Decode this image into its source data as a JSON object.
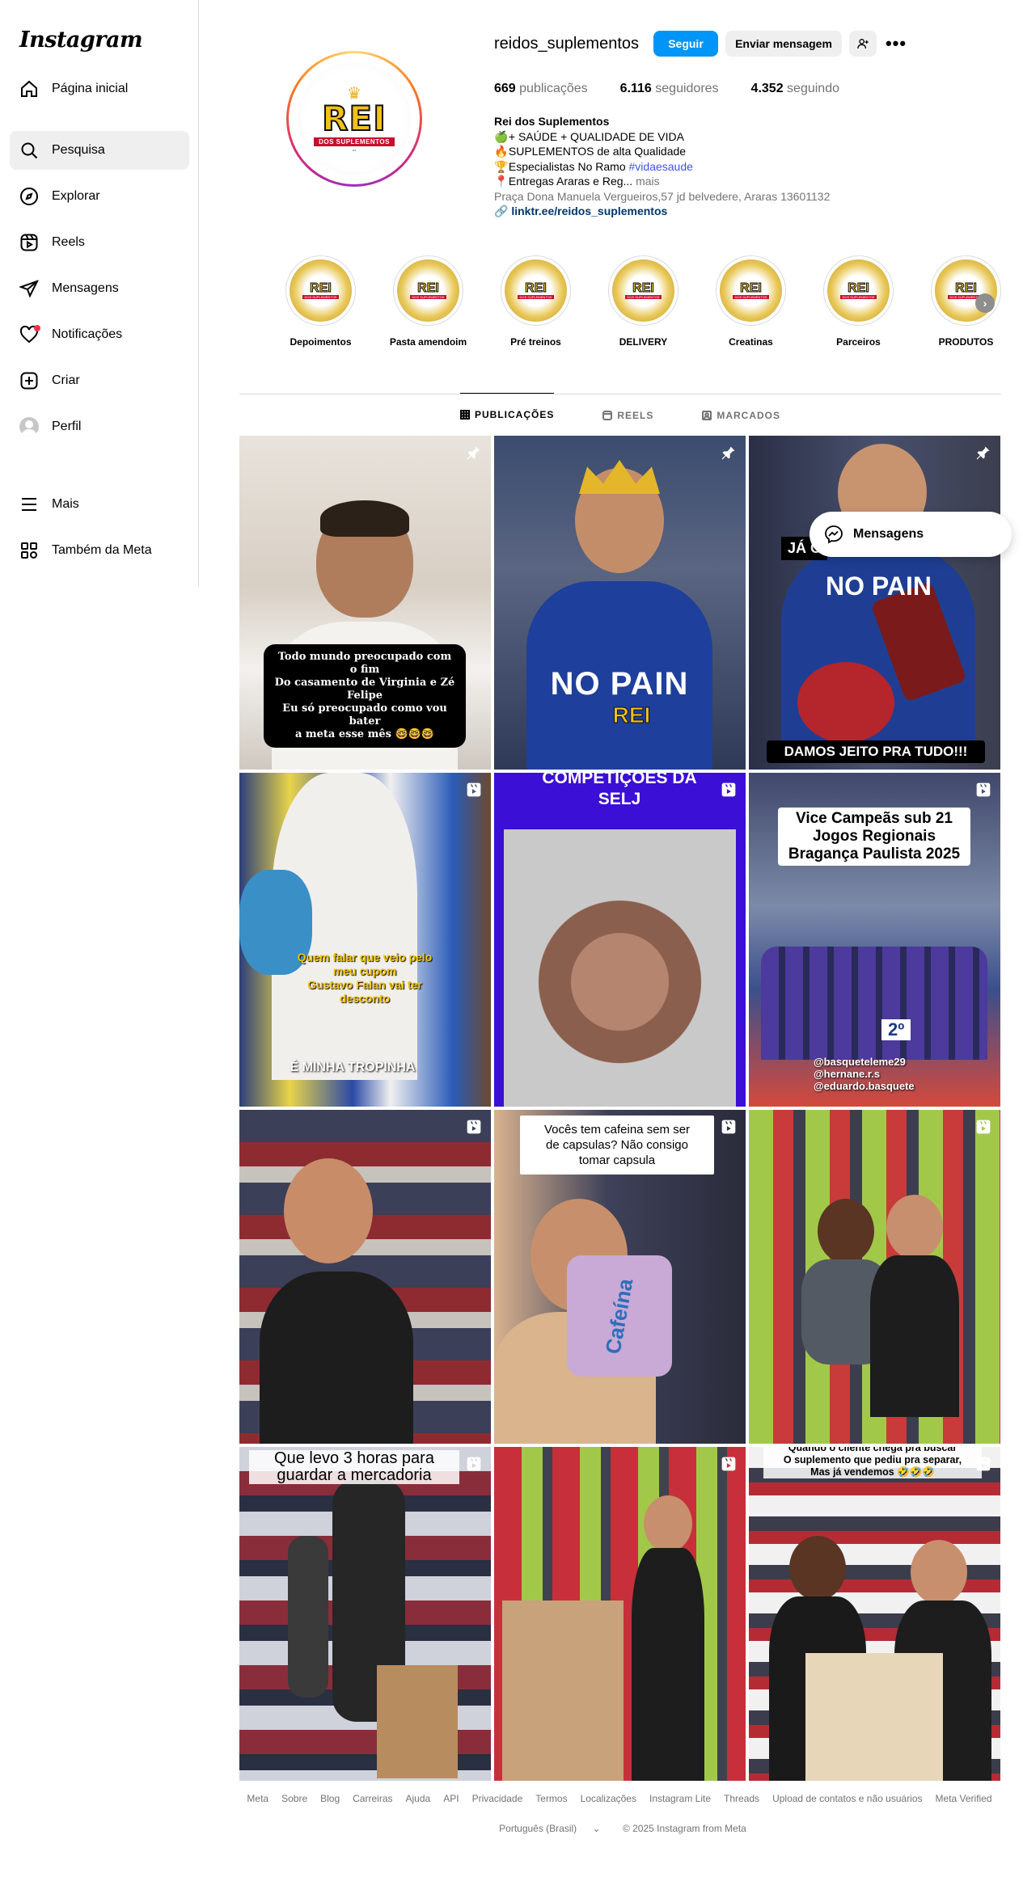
{
  "app": {
    "logo": "Instagram"
  },
  "sidebar": {
    "items": [
      {
        "label": "Página inicial",
        "icon": "home-icon"
      },
      {
        "label": "Pesquisa",
        "icon": "search-icon"
      },
      {
        "label": "Explorar",
        "icon": "compass-icon"
      },
      {
        "label": "Reels",
        "icon": "reels-icon"
      },
      {
        "label": "Mensagens",
        "icon": "send-icon"
      },
      {
        "label": "Notificações",
        "icon": "heart-icon"
      },
      {
        "label": "Criar",
        "icon": "plus-square-icon"
      },
      {
        "label": "Perfil",
        "icon": "avatar"
      },
      {
        "label": "Mais",
        "icon": "menu-icon"
      },
      {
        "label": "Também da Meta",
        "icon": "grid-icon"
      }
    ]
  },
  "profile": {
    "username": "reidos_suplementos",
    "follow_label": "Seguir",
    "message_label": "Enviar mensagem",
    "logo_text": "REI",
    "logo_sub": "DOS SUPLEMENTOS",
    "stats": {
      "posts_value": "669",
      "posts_label": "publicações",
      "followers_value": "6.116",
      "followers_label": "seguidores",
      "following_value": "4.352",
      "following_label": "seguindo"
    },
    "bio": {
      "name": "Rei dos Suplementos",
      "line1_emoji": "🍏",
      "line1": "+ SAÚDE + QUALIDADE DE VIDA",
      "line2_emoji": "🔥",
      "line2": "SUPLEMENTOS de alta Qualidade",
      "line3_emoji": "🏆",
      "line3": "Especialistas No Ramo",
      "line3_tag": "#vidaesaude",
      "line4_emoji": "📍",
      "line4": "Entregas Araras e Reg...",
      "more": "mais",
      "address": "Praça Dona Manuela Vergueiros,57 jd belvedere, Araras 13601132",
      "link": "linktr.ee/reidos_suplementos"
    }
  },
  "highlights": [
    {
      "label": "Depoimentos"
    },
    {
      "label": "Pasta amendoim"
    },
    {
      "label": "Pré treinos"
    },
    {
      "label": "DELIVERY"
    },
    {
      "label": "Creatinas"
    },
    {
      "label": "Parceiros"
    },
    {
      "label": "PRODUTOS"
    }
  ],
  "tabs": [
    {
      "label": "PUBLICAÇÕES"
    },
    {
      "label": "REELS"
    },
    {
      "label": "MARCADOS"
    }
  ],
  "posts": {
    "p1_caption": "Todo mundo preocupado com o fim\nDo casamento de Virginia e Zé Felipe\nEu só preocupado como vou bater\na meta esse mês 🤓🤓🤓",
    "p2_text": "NO PAIN",
    "p3_top": "JÁ C",
    "p3_caption": "DAMOS JEITO PRA TUDO!!!",
    "p3_shirt": "NO PAIN",
    "p4_caption": "Quem falar que veio pelo\nmeu cupom\nGustavo Falan vai ter\ndesconto",
    "p4_bottom": "É MINHA TROPINHA",
    "p5_title": "COMPETIÇÕES  DA\nSELJ",
    "p6_title": "Vice Campeãs sub 21\nJogos Regionais\nBragança Paulista 2025",
    "p6_place": "2º",
    "p6_tags": "@basqueteleme29\n@hernane.r.s\n@eduardo.basquete",
    "p8_note": "Vocês tem cafeina sem ser\nde capsulas? Não consigo\ntomar capsula",
    "p8_label": "Cafeína",
    "p10_caption": "Que levo 3 horas para\nguardar a mercadoria",
    "p12_caption": "Quando o cliente chega pra buscar\nO suplemento que pediu pra separar,\nMas já vendemos 🤣🤣🤣"
  },
  "messages_pill": {
    "label": "Mensagens"
  },
  "footer": {
    "links": [
      "Meta",
      "Sobre",
      "Blog",
      "Carreiras",
      "Ajuda",
      "API",
      "Privacidade",
      "Termos",
      "Localizações",
      "Instagram Lite",
      "Threads",
      "Upload de contatos e não usuários",
      "Meta Verified"
    ],
    "language": "Português (Brasil)",
    "copyright": "© 2025 Instagram from Meta"
  },
  "colors": {
    "primary_button": "#0095f6",
    "link": "#00376b",
    "hashtag": "#4150f7",
    "notification_dot": "#ff3040"
  }
}
